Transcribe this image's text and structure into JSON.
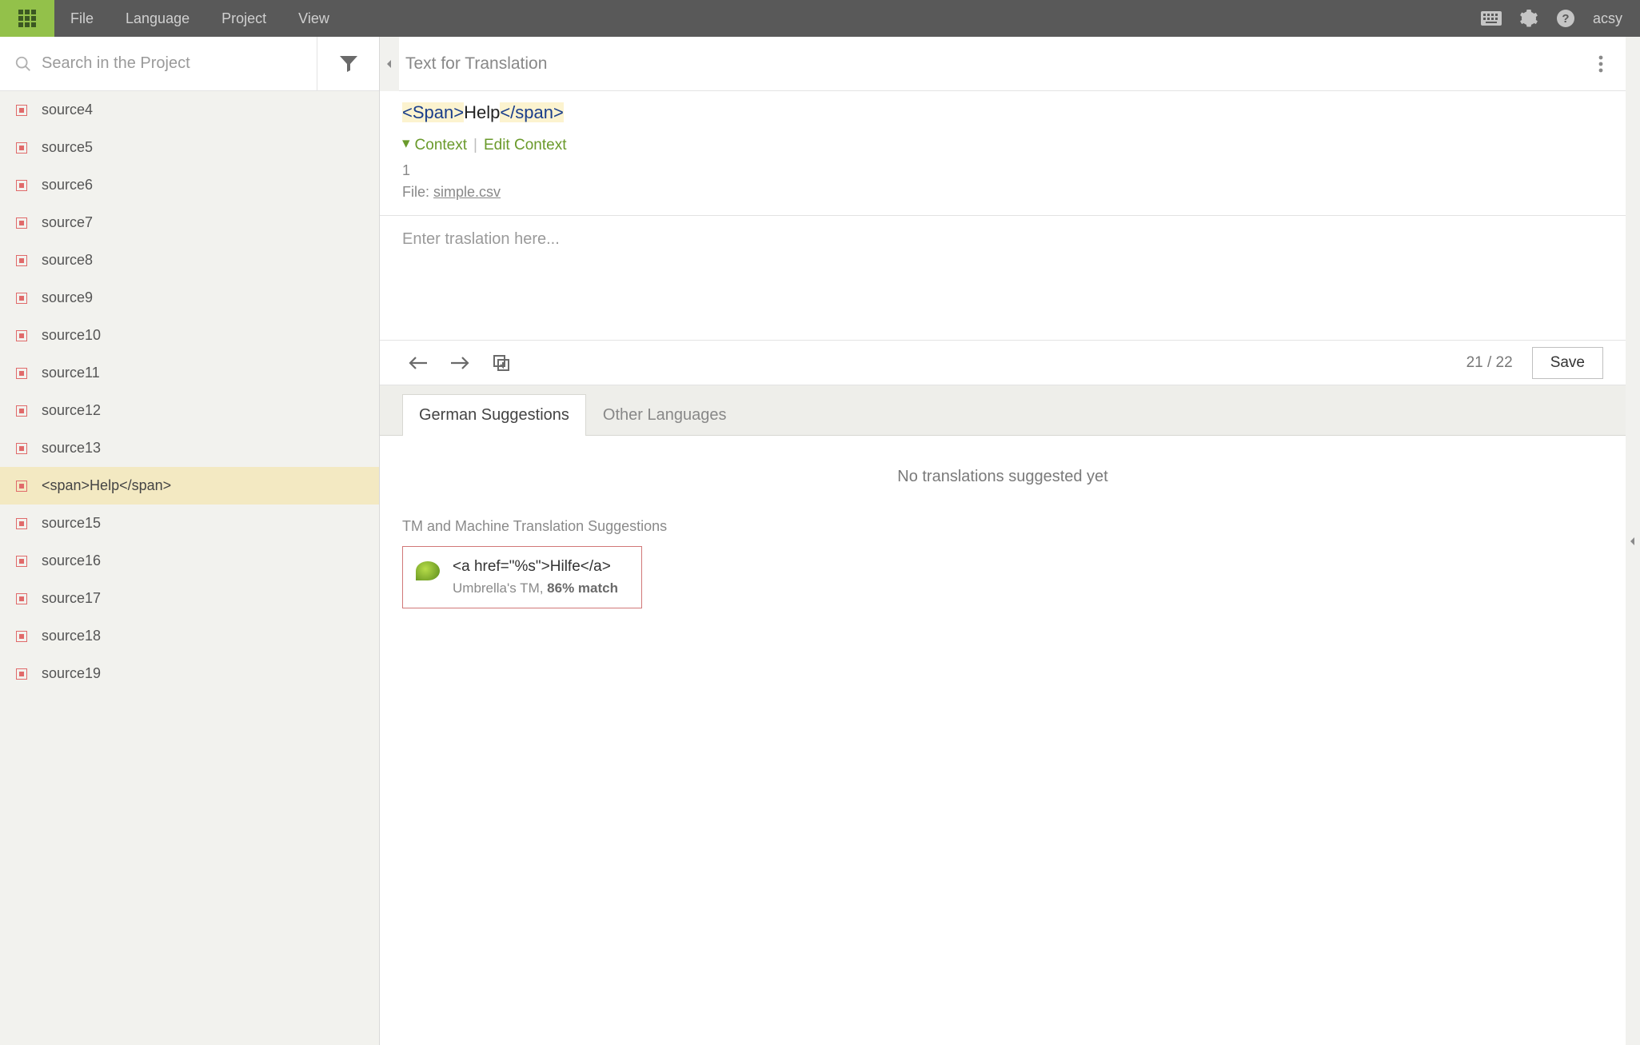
{
  "topbar": {
    "menu": [
      "File",
      "Language",
      "Project",
      "View"
    ],
    "username": "acsy"
  },
  "sidebar": {
    "search_placeholder": "Search in the Project",
    "items": [
      {
        "label": "source4",
        "active": false
      },
      {
        "label": "source5",
        "active": false
      },
      {
        "label": "source6",
        "active": false
      },
      {
        "label": "source7",
        "active": false
      },
      {
        "label": "source8",
        "active": false
      },
      {
        "label": "source9",
        "active": false
      },
      {
        "label": "source10",
        "active": false
      },
      {
        "label": "source11",
        "active": false
      },
      {
        "label": "source12",
        "active": false
      },
      {
        "label": "source13",
        "active": false
      },
      {
        "label": "<span>Help</span>",
        "active": true
      },
      {
        "label": "source15",
        "active": false
      },
      {
        "label": "source16",
        "active": false
      },
      {
        "label": "source17",
        "active": false
      },
      {
        "label": "source18",
        "active": false
      },
      {
        "label": "source19",
        "active": false
      }
    ]
  },
  "editor": {
    "header_title": "Text for Translation",
    "source_tag_open": "<Span>",
    "source_text": "Help",
    "source_tag_close": "</span>",
    "context_label": "Context",
    "edit_context_label": "Edit Context",
    "context_number": "1",
    "file_label": "File: ",
    "file_name": "simple.csv",
    "translation_placeholder": "Enter traslation here...",
    "counter": "21 / 22",
    "save_label": "Save",
    "tabs": {
      "german": "German Suggestions",
      "other": "Other Languages"
    },
    "no_suggestions": "No translations suggested yet",
    "tm_heading": "TM and Machine Translation Suggestions",
    "tm_entry": {
      "text": "<a href=\"%s\">Hilfe</a>",
      "source": "Umbrella's TM, ",
      "match": "86% match"
    }
  }
}
